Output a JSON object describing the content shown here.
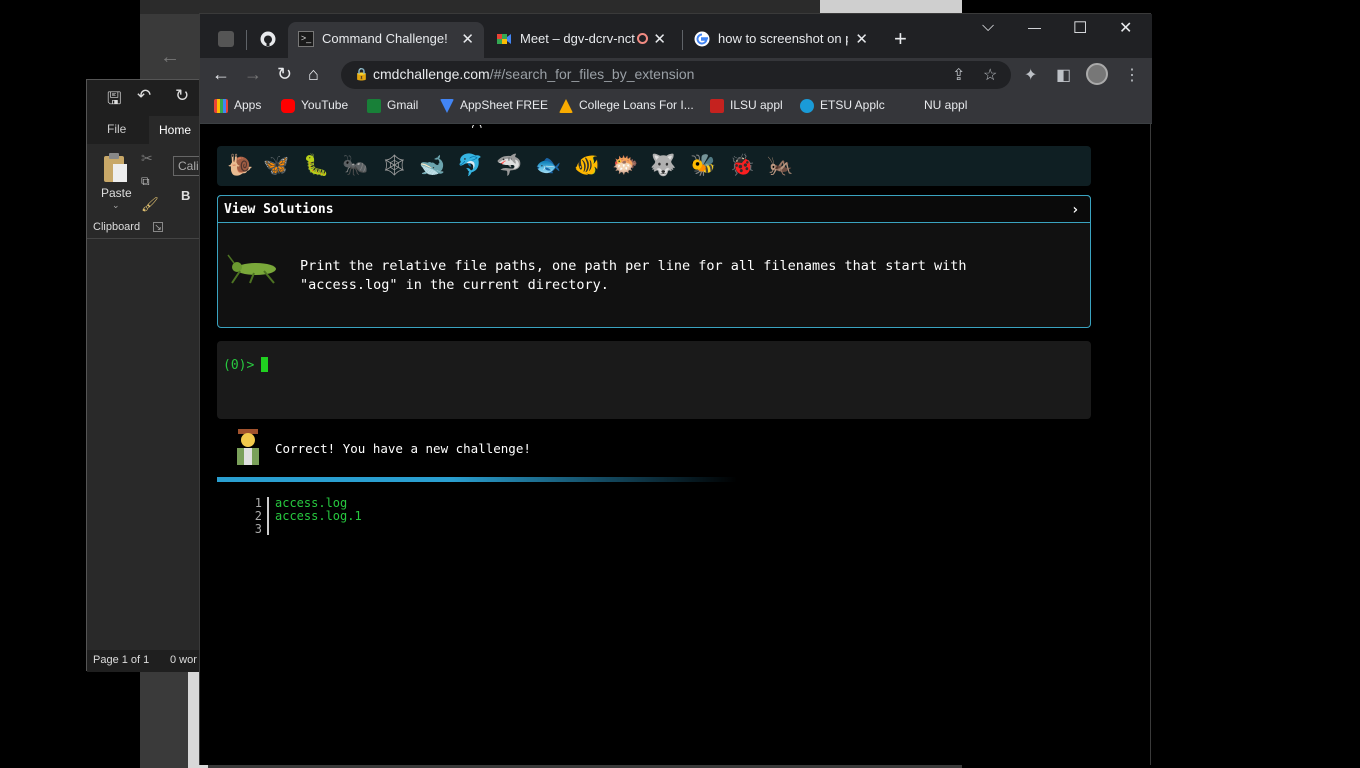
{
  "word": {
    "tabs": {
      "file": "File",
      "home": "Home"
    },
    "clipboard": {
      "paste_label": "Paste",
      "group_label": "Clipboard"
    },
    "font_name": "Calibri",
    "bold_label": "B",
    "status": {
      "page": "Page 1 of 1",
      "words": "0 wor"
    }
  },
  "browser": {
    "tabs": [
      {
        "title": "Command Challenge!",
        "active": true
      },
      {
        "title": "Meet – dgv-dcrv-nct",
        "recording": true
      },
      {
        "title": "how to screenshot on pc"
      }
    ],
    "new_tab": "+",
    "window_controls": {
      "dropdown": "⌵",
      "minimize": "—",
      "maximize": "☐",
      "close": "✕"
    },
    "url": {
      "host": "cmdchallenge.com",
      "path": "/#/search_for_files_by_extension"
    },
    "bookmarks": [
      "Apps",
      "YouTube",
      "Gmail",
      "AppSheet FREE",
      "College Loans For I...",
      "ILSU appl",
      "ETSU Applc",
      "NU appl"
    ]
  },
  "page": {
    "view_solutions": "View Solutions",
    "challenge_text": "Print the relative file paths, one path per line for all filenames that start with \"access.log\" in the current directory.",
    "prompt": "(0)> ",
    "result_message": "Correct! You have a new challenge!",
    "output_lines": [
      {
        "num": "1",
        "text": "access.log"
      },
      {
        "num": "2",
        "text": "access.log.1"
      },
      {
        "num": "3",
        "text": ""
      }
    ]
  }
}
